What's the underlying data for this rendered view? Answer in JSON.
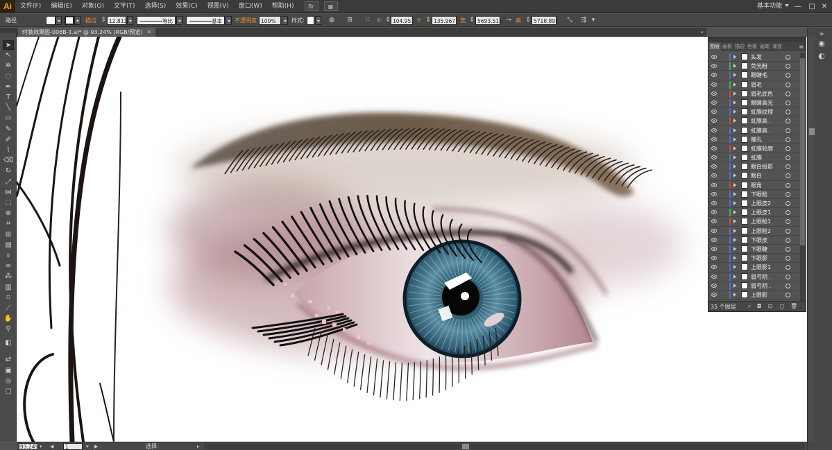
{
  "app": {
    "logo": "Ai",
    "workspace": "基本功能",
    "window_controls": [
      "—",
      "□",
      "✕"
    ]
  },
  "menu": [
    "文件(F)",
    "编辑(E)",
    "对象(O)",
    "文字(T)",
    "选择(S)",
    "效果(C)",
    "视图(V)",
    "窗口(W)",
    "帮助(H)"
  ],
  "control": {
    "selection_label": "路径",
    "stroke_label": "描边",
    "stroke_weight": "12.813",
    "profile_label": "等比",
    "brush_label": "基本",
    "opacity_label": "不透明度",
    "opacity_value": "100%",
    "style_label": "样式:",
    "x_label": "X:",
    "x_value": "104.951",
    "y_label": "Y:",
    "y_value": "135.967",
    "w_label": "宽",
    "w_value": "5693.511",
    "h_label": "高",
    "h_value": "5718.891"
  },
  "document": {
    "tab_title": "时装效果图-006B-1.ai* @ 93.24% (RGB/预览)",
    "close": "✕",
    "collapse": "«"
  },
  "layers_panel": {
    "tabs": [
      "图层",
      "画板",
      "描边",
      "色板",
      "画笔",
      "渐变"
    ],
    "menu": "≡",
    "footer_count": "35 个图层",
    "layers": [
      {
        "name": "头发",
        "color": "#4f6fd1"
      },
      {
        "name": "荧光粉",
        "color": "#3fb84a"
      },
      {
        "name": "眼睫毛",
        "color": "#4f6fd1"
      },
      {
        "name": "眉毛",
        "color": "#3fb84a"
      },
      {
        "name": "眉毛底色",
        "color": "#d94040"
      },
      {
        "name": "眼睛高光",
        "color": "#4f6fd1"
      },
      {
        "name": "虹膜纹理",
        "color": "#4f6fd1"
      },
      {
        "name": "虹膜高 .",
        "color": "#d94040"
      },
      {
        "name": "虹膜高 .",
        "color": "#4f6fd1"
      },
      {
        "name": "瞳孔",
        "color": "#4f6fd1"
      },
      {
        "name": "虹膜轮廓",
        "color": "#d94040"
      },
      {
        "name": "虹膜",
        "color": "#4f6fd1"
      },
      {
        "name": "眼白投影",
        "color": "#4f6fd1"
      },
      {
        "name": "眼白",
        "color": "#4f6fd1"
      },
      {
        "name": "眼角",
        "color": "#d94040"
      },
      {
        "name": "下眼睑",
        "color": "#4f6fd1"
      },
      {
        "name": "上眼皮2",
        "color": "#4f6fd1"
      },
      {
        "name": "上眼皮1",
        "color": "#3fb84a"
      },
      {
        "name": "上眼睑1",
        "color": "#d94040"
      },
      {
        "name": "上眼睑2",
        "color": "#4f6fd1"
      },
      {
        "name": "下眼皮",
        "color": "#4f6fd1"
      },
      {
        "name": "下眼睫",
        "color": "#4f6fd1"
      },
      {
        "name": "下眼影",
        "color": "#4f6fd1"
      },
      {
        "name": "上眼影1",
        "color": "#4f6fd1"
      },
      {
        "name": "眉弓阴 .",
        "color": "#4f6fd1"
      },
      {
        "name": "眉弓阴 .",
        "color": "#4f6fd1"
      },
      {
        "name": "上眼影",
        "color": "#4f6fd1"
      }
    ]
  },
  "status": {
    "zoom": "93.24%",
    "page": "1",
    "tool": "选择"
  },
  "colors": {
    "iris": "#3e6f86",
    "brow": "#6b5a48",
    "shadow": "#a06a70"
  }
}
